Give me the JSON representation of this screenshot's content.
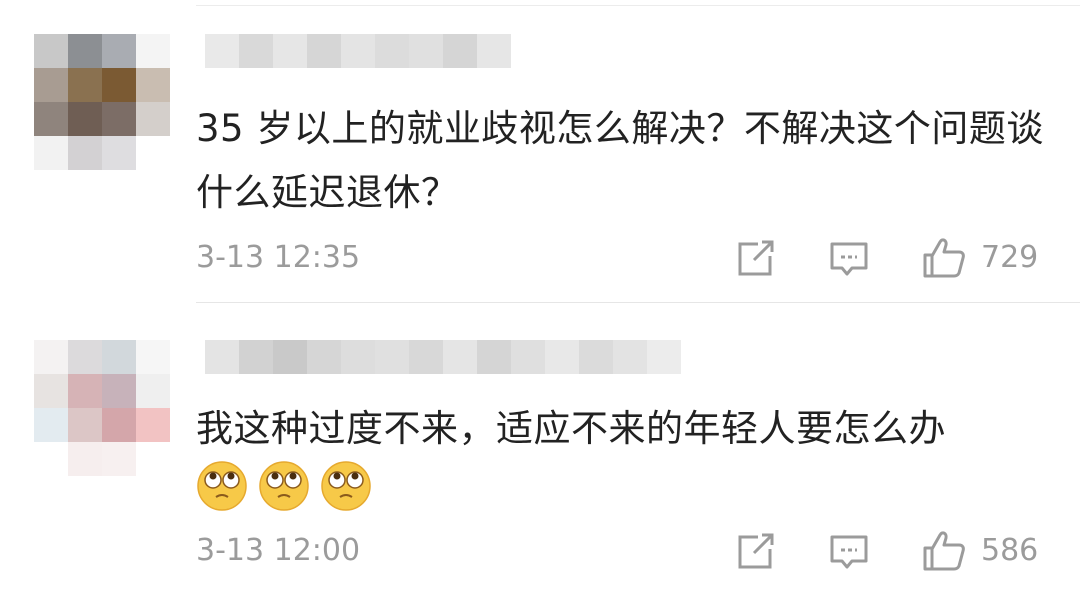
{
  "comments": [
    {
      "text": "35 岁以上的就业歧视怎么解决？不解决这个问题谈什么延迟退休？",
      "timestamp": "3-13 12:35",
      "likes": "729",
      "share_icon": "share-edit-icon",
      "reply_icon": "comment-bubble-icon",
      "like_icon": "thumbs-up-icon",
      "emojis": []
    },
    {
      "text": "我这种过度不来，适应不来的年轻人要怎么办",
      "timestamp": "3-13 12:00",
      "likes": "586",
      "share_icon": "share-edit-icon",
      "reply_icon": "comment-bubble-icon",
      "like_icon": "thumbs-up-icon",
      "emojis": [
        "eye-roll-emoji",
        "eye-roll-emoji",
        "eye-roll-emoji"
      ]
    }
  ],
  "colors": {
    "text": "#222222",
    "meta": "#9b9b9b",
    "divider": "#e6e6e6",
    "emoji_face": "#f7c948"
  }
}
